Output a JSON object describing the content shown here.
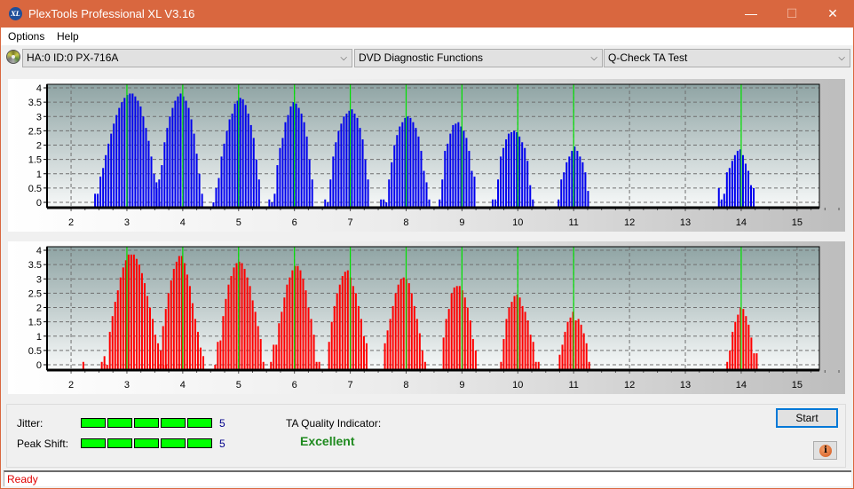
{
  "window": {
    "title": "PlexTools Professional XL V3.16",
    "app_icon_text": "XL",
    "controls": {
      "minimize": "—",
      "maximize": "☐",
      "close": "✕"
    }
  },
  "menu": {
    "items": [
      {
        "label": "Options"
      },
      {
        "label": "Help"
      }
    ]
  },
  "toolbar": {
    "drive": {
      "value": "HA:0 ID:0  PX-716A"
    },
    "function": {
      "value": "DVD Diagnostic Functions"
    },
    "test": {
      "value": "Q-Check TA Test"
    },
    "chevron": "⌵"
  },
  "results": {
    "jitter_label": "Jitter:",
    "jitter_value": "5",
    "jitter_level": 5,
    "peak_shift_label": "Peak Shift:",
    "peak_shift_value": "5",
    "peak_shift_level": 5,
    "meter_max": 5,
    "ta_quality_label": "TA Quality Indicator:",
    "ta_quality_value": "Excellent",
    "start_label": "Start",
    "info_glyph": "i"
  },
  "status": {
    "text": "Ready"
  },
  "colors": {
    "titlebar": "#d9673f",
    "bar_top": "#0000ee",
    "bar_bottom": "#ff0000",
    "marker": "#00e000",
    "meter": "#00ff00",
    "quality": "#1f8a1f",
    "status": "#e00000"
  },
  "chart_data": [
    {
      "type": "bar",
      "title": "",
      "xlabel": "",
      "ylabel": "",
      "xlim": [
        1.57,
        15.4
      ],
      "ylim": [
        0,
        4.2
      ],
      "xticks": [
        "2",
        "3",
        "4",
        "5",
        "6",
        "7",
        "8",
        "9",
        "10",
        "11",
        "12",
        "13",
        "14",
        "15"
      ],
      "yticks": [
        "0",
        "0.5",
        "1",
        "1.5",
        "2",
        "2.5",
        "3",
        "3.5",
        "4"
      ],
      "grid": true,
      "markers": [
        3,
        4,
        5,
        6,
        7,
        8,
        9,
        10,
        11,
        14
      ],
      "bar_step": 0.048,
      "series": [
        {
          "name": "top",
          "color": "#0000ee",
          "clusters": [
            {
              "start": 2.43,
              "values": [
                0.3,
                0.3,
                0.9,
                1.2,
                1.65,
                2.05,
                2.4,
                2.75,
                3.05,
                3.3,
                3.5,
                3.65,
                3.75,
                3.8,
                3.8,
                3.7,
                3.55,
                3.35,
                3.0,
                2.6,
                2.15,
                1.6,
                1.0,
                0.5,
                0
              ]
            },
            {
              "start": 3.53,
              "values": [
                0.7,
                0.8,
                1.3,
                2.1,
                2.6,
                3.0,
                3.3,
                3.55,
                3.7,
                3.8,
                3.7,
                3.55,
                3.3,
                2.9,
                2.4,
                1.7,
                1.0,
                0.3
              ]
            },
            {
              "start": 4.55,
              "values": [
                0,
                0.5,
                0.85,
                1.6,
                2.05,
                2.5,
                2.9,
                3.1,
                3.45,
                3.55,
                3.65,
                3.6,
                3.4,
                3.1,
                2.7,
                2.25,
                1.5,
                0.8
              ]
            },
            {
              "start": 5.55,
              "values": [
                0.1,
                0,
                0.3,
                1.3,
                1.9,
                2.25,
                2.8,
                3.05,
                3.35,
                3.5,
                3.45,
                3.3,
                3.1,
                2.8,
                2.3,
                1.5,
                0.8
              ]
            },
            {
              "start": 6.55,
              "values": [
                0.1,
                0,
                0.8,
                1.6,
                2.1,
                2.5,
                2.75,
                3.0,
                3.1,
                3.2,
                3.25,
                3.1,
                2.95,
                2.6,
                2.2,
                1.5,
                0.8
              ]
            },
            {
              "start": 7.55,
              "values": [
                0.1,
                0.1,
                0,
                0.8,
                1.4,
                2.0,
                2.35,
                2.65,
                2.8,
                2.95,
                3.0,
                2.95,
                2.8,
                2.6,
                2.3,
                1.8,
                1.1,
                0.7,
                0.1
              ]
            },
            {
              "start": 8.6,
              "values": [
                0.1,
                0.8,
                1.8,
                2.05,
                2.4,
                2.7,
                2.75,
                2.8,
                2.65,
                2.5,
                2.25,
                1.8,
                1.1,
                0.9
              ]
            },
            {
              "start": 9.55,
              "values": [
                0.1,
                0.1,
                0.8,
                1.6,
                1.9,
                2.2,
                2.4,
                2.45,
                2.5,
                2.45,
                2.3,
                2.1,
                1.9,
                1.45,
                0.6,
                0.1
              ]
            },
            {
              "start": 10.73,
              "values": [
                0.1,
                0.8,
                1.05,
                1.4,
                1.6,
                1.8,
                1.95,
                1.8,
                1.6,
                1.4,
                1.05,
                0.4
              ]
            },
            {
              "start": 13.6,
              "values": [
                0.5,
                0.1,
                0.3,
                1.05,
                1.2,
                1.45,
                1.65,
                1.8,
                1.85,
                1.65,
                1.35,
                1.1,
                0.6,
                0.5
              ]
            }
          ]
        }
      ]
    },
    {
      "type": "bar",
      "title": "",
      "xlabel": "",
      "ylabel": "",
      "xlim": [
        1.57,
        15.4
      ],
      "ylim": [
        0,
        4.2
      ],
      "xticks": [
        "2",
        "3",
        "4",
        "5",
        "6",
        "7",
        "8",
        "9",
        "10",
        "11",
        "12",
        "13",
        "14",
        "15"
      ],
      "yticks": [
        "0",
        "0.5",
        "1",
        "1.5",
        "2",
        "2.5",
        "3",
        "3.5",
        "4"
      ],
      "grid": true,
      "markers": [
        3,
        4,
        5,
        6,
        7,
        8,
        9,
        10,
        11,
        14
      ],
      "bar_step": 0.048,
      "series": [
        {
          "name": "bottom",
          "color": "#ff0000",
          "clusters": [
            {
              "start": 2.22,
              "values": [
                0.1
              ]
            },
            {
              "start": 2.55,
              "values": [
                0.1,
                0.3,
                0,
                1.15,
                1.7,
                2.2,
                2.6,
                3.05,
                3.4,
                3.65,
                3.85,
                3.85,
                3.85,
                3.7,
                3.5,
                3.2,
                2.85,
                2.4,
                2.0,
                1.6,
                1.05,
                0.75,
                0.5,
                0,
                0
              ]
            },
            {
              "start": 3.6,
              "values": [
                0,
                1.35,
                1.95,
                2.5,
                2.95,
                3.35,
                3.6,
                3.8,
                3.8,
                3.55,
                3.15,
                2.75,
                2.15,
                1.6,
                1.15,
                0.6,
                0.3
              ]
            },
            {
              "start": 4.58,
              "values": [
                0,
                0.8,
                0.85,
                1.7,
                2.3,
                2.8,
                3.1,
                3.4,
                3.55,
                3.6,
                3.55,
                3.35,
                3.05,
                2.75,
                2.25,
                1.85,
                1.35,
                0.9,
                0.1
              ]
            },
            {
              "start": 5.58,
              "values": [
                0.1,
                0.7,
                0.7,
                1.45,
                1.85,
                2.35,
                2.8,
                3.05,
                3.3,
                3.45,
                3.45,
                3.3,
                3.0,
                2.6,
                2.0,
                1.6,
                1.05,
                0.1,
                0.1
              ]
            },
            {
              "start": 6.62,
              "values": [
                0.8,
                1.5,
                2.05,
                2.5,
                2.8,
                3.1,
                3.25,
                3.3,
                3.05,
                2.75,
                2.5,
                2.05,
                1.6,
                1.0,
                0.75
              ]
            },
            {
              "start": 7.62,
              "values": [
                0.75,
                1.2,
                1.6,
                2.05,
                2.5,
                2.8,
                3.0,
                3.05,
                3.0,
                2.85,
                2.5,
                2.05,
                1.6,
                1.1,
                0.5,
                0.1
              ]
            },
            {
              "start": 8.67,
              "values": [
                0.95,
                1.6,
                1.95,
                2.5,
                2.7,
                2.75,
                2.75,
                2.6,
                2.35,
                2.0,
                1.55,
                0.9,
                0.5
              ]
            },
            {
              "start": 9.7,
              "values": [
                0.1,
                0.9,
                1.6,
                2.0,
                2.2,
                2.4,
                2.45,
                2.35,
                2.05,
                1.85,
                1.55,
                1.05,
                0.8,
                0.1,
                0.1
              ]
            },
            {
              "start": 10.75,
              "values": [
                0.35,
                0.7,
                1.15,
                1.5,
                1.65,
                1.85,
                1.55,
                1.6,
                1.4,
                1.1,
                0.75,
                0.1
              ]
            },
            {
              "start": 13.75,
              "values": [
                0.1,
                0.5,
                1.15,
                1.5,
                1.75,
                2.0,
                1.95,
                1.7,
                1.4,
                0.95,
                0.4,
                0.4
              ]
            }
          ]
        }
      ]
    }
  ]
}
